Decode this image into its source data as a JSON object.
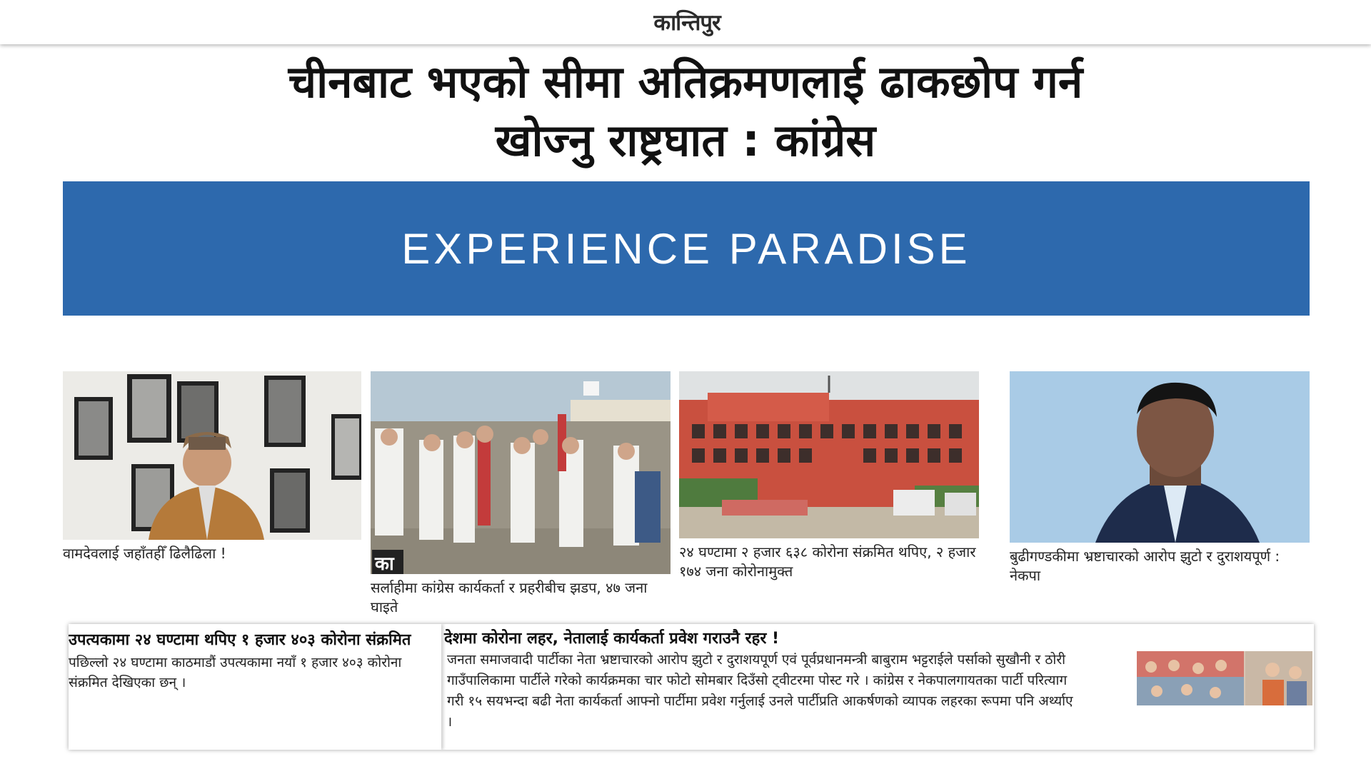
{
  "header": {
    "logo_text": "कान्तिपुर"
  },
  "article": {
    "headline_line1": "चीनबाट भएको सीमा अतिक्रमणलाई ढाकछोप गर्न",
    "headline_line2": "खोज्नु राष्ट्रघात : कांग्रेस"
  },
  "ad": {
    "text": "EXPERIENCE PARADISE",
    "background": "#2d69ad"
  },
  "related": [
    {
      "caption": "वामदेवलाई जहाँतहीँ ढिलैढिला !"
    },
    {
      "caption": "सर्लाहीमा कांग्रेस कार्यकर्ता र प्रहरीबीच झडप, ४७ जना घाइते",
      "watermark": "का"
    },
    {
      "caption": "२४ घण्टामा २ हजार ६३८ कोरोना संक्रमित थपिए, २ हजार १७४ जना कोरोनामुक्त"
    },
    {
      "caption": "बुढीगण्डकीमा भ्रष्टाचारको आरोप झुटो र दुराशयपूर्ण : नेकपा"
    }
  ],
  "bottom": {
    "left_title": "उपत्यकामा २४ घण्टामा थपिए १ हजार ४०३ कोरोना संक्रमित",
    "left_body": "पछिल्लो २४ घण्टामा काठमाडौं उपत्यकामा नयाँ १ हजार ४०३ कोरोना संक्रमित देखिएका छन् ।",
    "right_title": "देशमा कोरोना लहर, नेतालाई कार्यकर्ता प्रवेश गराउनै रहर !",
    "right_body_line1": "जनता समाजवादी पार्टीका नेता भ्रष्टाचारको आरोप झुटो र दुराशयपूर्ण एवं पूर्वप्रधानमन्त्री बाबुराम भट्टराईले पर्साको सुखौनी र ठोरी",
    "right_body_line2": "गाउँपालिकामा पार्टीले गरेको कार्यक्रमका चार फोटो सोमबार दिउँसो ट्वीटरमा पोस्ट गरे । कांग्रेस र नेकपालगायतका पार्टी परित्याग",
    "right_body_line3": "गरी १५ सयभन्दा बढी नेता कार्यकर्ता आफ्नो पार्टीमा प्रवेश गर्नुलाई उनले पार्टीप्रति आकर्षणको व्यापक लहरका रूपमा पनि अर्थ्याए",
    "right_body_line4": "।"
  }
}
